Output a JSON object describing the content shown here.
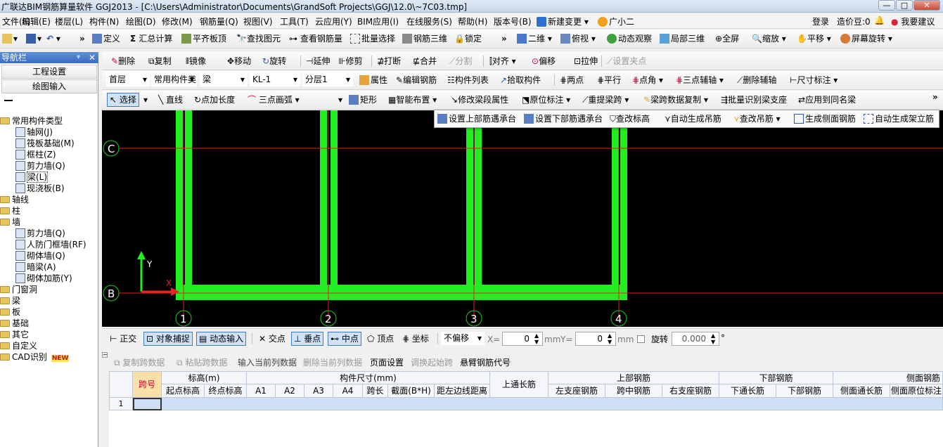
{
  "window": {
    "title": "广联达BIM钢筋算量软件 GGJ2013 - [C:\\Users\\Administrator\\Documents\\GrandSoft Projects\\GGJ\\12.0\\~7C03.tmp]",
    "min_btn": "—",
    "max_btn": "□",
    "close_btn": "✕"
  },
  "menubar": {
    "items": [
      "文件(F)",
      "编辑(E)",
      "楼层(L)",
      "构件(N)",
      "绘图(D)",
      "修改(M)",
      "钢筋量(Q)",
      "视图(V)",
      "工具(T)",
      "云应用(Y)",
      "BIM应用(I)",
      "在线服务(S)",
      "帮助(H)",
      "版本号(B)"
    ],
    "new_change": "新建变更",
    "assistant": "广小二",
    "login": "登录",
    "beans": "造价豆:0",
    "suggest": "我要建议"
  },
  "toolbar1": {
    "define": "定义",
    "calc": "汇总计算",
    "flat_board": "平齐板顶",
    "find": "查找图元",
    "view_rebar": "查看钢筋量",
    "batch_select": "批量选择",
    "rebar_3d": "钢筋三维",
    "lock": "锁定",
    "view2d": "二维",
    "top_view": "俯视",
    "dynamic": "动态观察",
    "local3d": "局部三维",
    "fullscreen": "全屏",
    "zoom": "缩放",
    "pan": "平移",
    "rotate_screen": "屏幕旋转"
  },
  "toolbar2": {
    "delete": "删除",
    "copy": "复制",
    "mirror": "镜像",
    "move": "移动",
    "rotate": "旋转",
    "extend": "延伸",
    "trim": "修剪",
    "break": "打断",
    "merge": "合并",
    "split": "分割",
    "align": "对齐",
    "offset": "偏移",
    "stretch": "拉伸",
    "set_grip": "设置夹点"
  },
  "toolbar3": {
    "floor": "首层",
    "category": "常用构件类",
    "type": "梁",
    "element": "KL-1",
    "layer": "分层1",
    "props": "属性",
    "edit_rebar": "编辑钢筋",
    "element_list": "构件列表",
    "pick": "拾取构件",
    "two_points": "两点",
    "parallel": "平行",
    "point_angle": "点角",
    "three_point_aux": "三点辅轴",
    "delete_aux": "删除辅轴",
    "dim": "尺寸标注"
  },
  "toolbar4": {
    "select": "选择",
    "line": "直线",
    "point_len": "点加长度",
    "arc3": "三点画弧",
    "rect": "矩形",
    "smart": "智能布置",
    "modify_span": "修改梁段属性",
    "orig_mark": "原位标注",
    "re_span": "重提梁跨",
    "span_copy": "梁跨数据复制",
    "batch_support": "批量识别梁支座",
    "apply_same": "应用到同名梁"
  },
  "dropmenu": {
    "items": [
      "设置上部筋遇承台",
      "设置下部筋遇承台",
      "查改标高",
      "自动生成吊筋",
      "查改吊筋",
      "生成侧面钢筋",
      "自动生成架立筋"
    ]
  },
  "nav": {
    "title": "导航栏",
    "pin": "ᵠ",
    "close": "✕",
    "project_settings": "工程设置",
    "drawing_input": "绘图输入",
    "tree": [
      {
        "label": "常用构件类型",
        "level": 0,
        "kind": "folder-open"
      },
      {
        "label": "轴网(J)",
        "level": 1,
        "kind": "item"
      },
      {
        "label": "筏板基础(M)",
        "level": 1,
        "kind": "item"
      },
      {
        "label": "框柱(Z)",
        "level": 1,
        "kind": "item"
      },
      {
        "label": "剪力墙(Q)",
        "level": 1,
        "kind": "item"
      },
      {
        "label": "梁(L)",
        "level": 1,
        "kind": "item-selected"
      },
      {
        "label": "现浇板(B)",
        "level": 1,
        "kind": "item"
      },
      {
        "label": "轴线",
        "level": 0,
        "kind": "folder"
      },
      {
        "label": "柱",
        "level": 0,
        "kind": "folder"
      },
      {
        "label": "墙",
        "level": 0,
        "kind": "folder-open"
      },
      {
        "label": "剪力墙(Q)",
        "level": 1,
        "kind": "item"
      },
      {
        "label": "人防门框墙(RF)",
        "level": 1,
        "kind": "item"
      },
      {
        "label": "砌体墙(Q)",
        "level": 1,
        "kind": "item"
      },
      {
        "label": "暗梁(A)",
        "level": 1,
        "kind": "item"
      },
      {
        "label": "砌体加筋(Y)",
        "level": 1,
        "kind": "item"
      },
      {
        "label": "门窗洞",
        "level": 0,
        "kind": "folder"
      },
      {
        "label": "梁",
        "level": 0,
        "kind": "folder"
      },
      {
        "label": "板",
        "level": 0,
        "kind": "folder"
      },
      {
        "label": "基础",
        "level": 0,
        "kind": "folder"
      },
      {
        "label": "其它",
        "level": 0,
        "kind": "folder"
      },
      {
        "label": "自定义",
        "level": 0,
        "kind": "folder"
      },
      {
        "label": "CAD识别",
        "level": 0,
        "kind": "folder"
      }
    ],
    "new_badge": "NEW"
  },
  "canvas": {
    "axis_labels": {
      "c": "C",
      "b": "B",
      "n1": "1",
      "n2": "2",
      "n3": "3",
      "n4": "4"
    },
    "ucs_x": "X",
    "ucs_y": "Y",
    "line_color": "#22ee22",
    "axis_color": "#e02020"
  },
  "statusbar": {
    "ortho": "正交",
    "snap": "对象捕捉",
    "dyn_input": "动态输入",
    "intersect": "交点",
    "perp": "垂点",
    "mid": "中点",
    "vertex": "顶点",
    "coord": "坐标",
    "offset_mode": "不偏移",
    "x_label": "X=",
    "x_val": "0",
    "y_label": "Y=",
    "y_val": "0",
    "mm1": "mm",
    "mm2": "mm",
    "rotate_label": "旋转",
    "rotate_val": "0.000",
    "degree": "°"
  },
  "bottom_toolbar": {
    "copy_span": "复制跨数据",
    "paste_span": "粘贴跨数据",
    "input_col": "输入当前列数据",
    "delete_col": "删除当前列数据",
    "page_setup": "页面设置",
    "swap_start": "调换起始跨",
    "cantilever": "悬臂钢筋代号"
  },
  "grid": {
    "h_span": "跨号",
    "h_elev": "标高(m)",
    "h_start_elev": "起点标高",
    "h_end_elev": "终点标高",
    "h_dims": "构件尺寸(mm)",
    "h_a1": "A1",
    "h_a2": "A2",
    "h_a3": "A3",
    "h_a4": "A4",
    "h_span_len": "跨长",
    "h_section": "截面(B*H)",
    "h_edge": "距左边线距离",
    "h_top_through": "上通长筋",
    "h_top_rebar": "上部钢筋",
    "h_left_sup": "左支座钢筋",
    "h_mid": "跨中钢筋",
    "h_right_sup": "右支座钢筋",
    "h_bottom_rebar": "下部钢筋",
    "h_bot_through": "下通长筋",
    "h_bot_rebar": "下部钢筋",
    "h_side_rebar": "侧面钢筋",
    "h_side_through": "侧面通长筋",
    "h_side_orig": "侧面原位标注",
    "row1": "1"
  }
}
